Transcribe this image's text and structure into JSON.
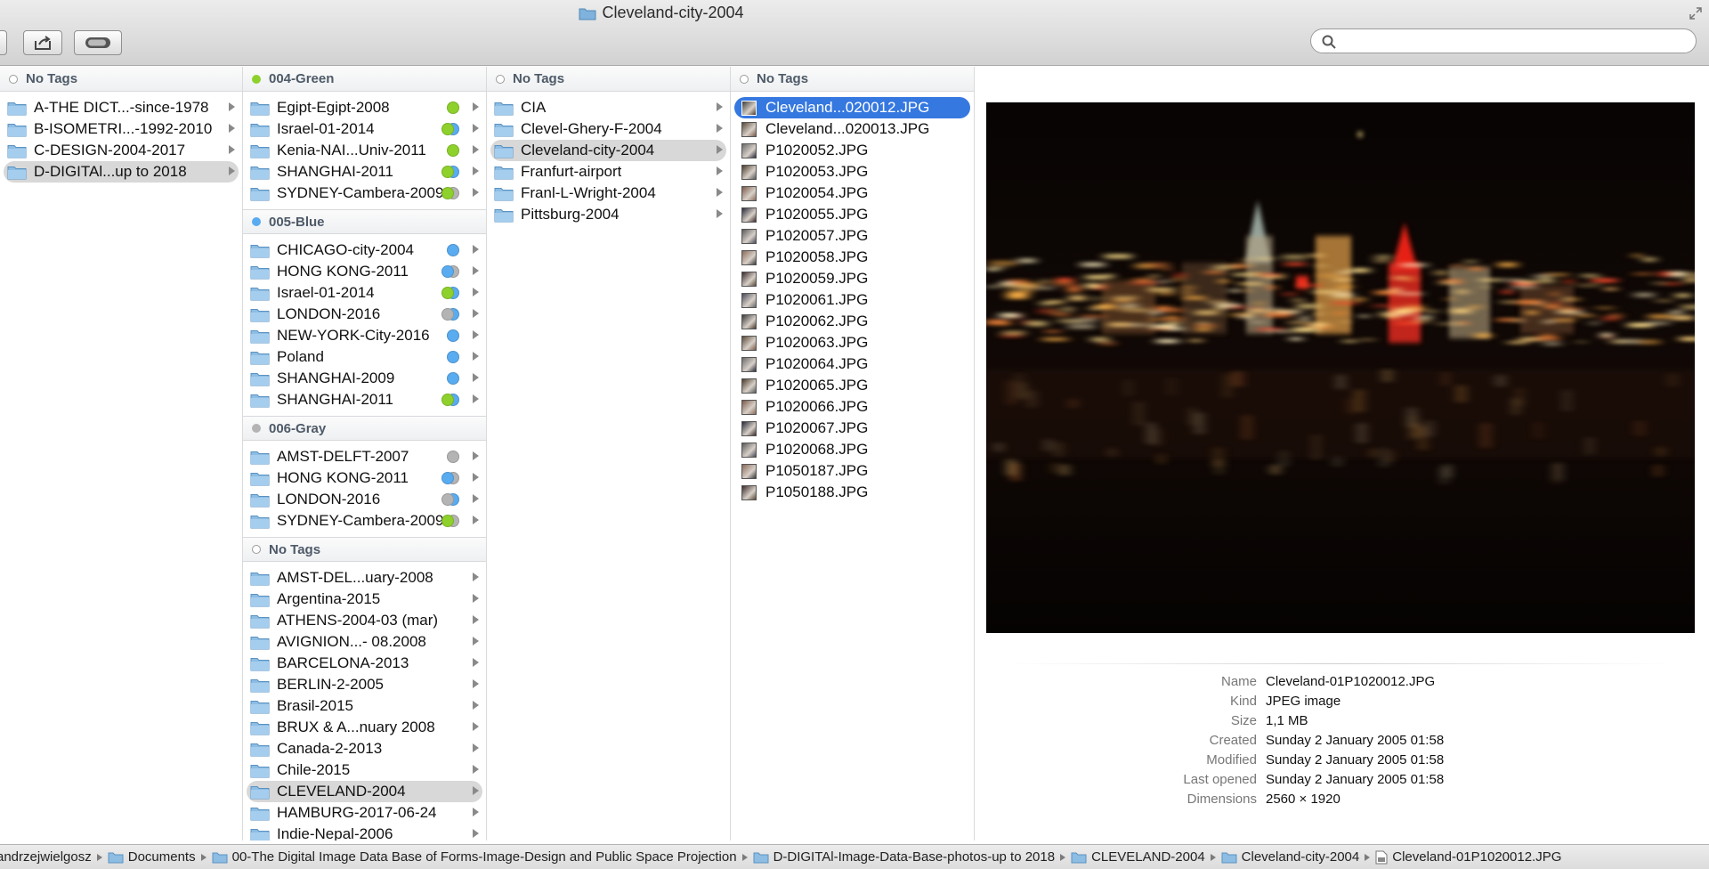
{
  "window": {
    "title": "Cleveland-city-2004"
  },
  "search": {
    "placeholder": "",
    "value": ""
  },
  "columns": [
    {
      "groups": [
        {
          "name": "No Tags",
          "dot": "empty",
          "items": [
            {
              "label": "A-THE DICT...-since-1978",
              "arrow": true
            },
            {
              "label": "B-ISOMETRI...-1992-2010",
              "arrow": true
            },
            {
              "label": "C-DESIGN-2004-2017",
              "arrow": true
            },
            {
              "label": "D-DIGITAl...up to 2018",
              "arrow": true,
              "selected": "gray"
            }
          ]
        }
      ]
    },
    {
      "groups": [
        {
          "name": "004-Green",
          "dot": "#8ed12c",
          "items": [
            {
              "label": "Egipt-Egipt-2008",
              "arrow": true,
              "tags": [
                "#8ed12c"
              ]
            },
            {
              "label": "Israel-01-2014",
              "arrow": true,
              "tags": [
                "#8ed12c",
                "#5aacf0"
              ]
            },
            {
              "label": "Kenia-NAI...Univ-2011",
              "arrow": true,
              "tags": [
                "#8ed12c"
              ]
            },
            {
              "label": "SHANGHAI-2011",
              "arrow": true,
              "tags": [
                "#8ed12c",
                "#5aacf0"
              ]
            },
            {
              "label": "SYDNEY-Cambera-2009",
              "arrow": true,
              "tags": [
                "#8ed12c",
                "#b4b4b4"
              ]
            }
          ]
        },
        {
          "name": "005-Blue",
          "dot": "#5aacf0",
          "items": [
            {
              "label": "CHICAGO-city-2004",
              "arrow": true,
              "tags": [
                "#5aacf0"
              ]
            },
            {
              "label": "HONG KONG-2011",
              "arrow": true,
              "tags": [
                "#5aacf0",
                "#b4b4b4"
              ]
            },
            {
              "label": "Israel-01-2014",
              "arrow": true,
              "tags": [
                "#8ed12c",
                "#5aacf0"
              ]
            },
            {
              "label": "LONDON-2016",
              "arrow": true,
              "tags": [
                "#b4b4b4",
                "#5aacf0"
              ]
            },
            {
              "label": "NEW-YORK-City-2016",
              "arrow": true,
              "tags": [
                "#5aacf0"
              ]
            },
            {
              "label": "Poland",
              "arrow": true,
              "tags": [
                "#5aacf0"
              ]
            },
            {
              "label": "SHANGHAI-2009",
              "arrow": true,
              "tags": [
                "#5aacf0"
              ]
            },
            {
              "label": "SHANGHAI-2011",
              "arrow": true,
              "tags": [
                "#8ed12c",
                "#5aacf0"
              ]
            }
          ]
        },
        {
          "name": "006-Gray",
          "dot": "#b4b4b4",
          "items": [
            {
              "label": "AMST-DELFT-2007",
              "arrow": true,
              "tags": [
                "#b4b4b4"
              ]
            },
            {
              "label": "HONG KONG-2011",
              "arrow": true,
              "tags": [
                "#5aacf0",
                "#b4b4b4"
              ]
            },
            {
              "label": "LONDON-2016",
              "arrow": true,
              "tags": [
                "#b4b4b4",
                "#5aacf0"
              ]
            },
            {
              "label": "SYDNEY-Cambera-2009",
              "arrow": true,
              "tags": [
                "#8ed12c",
                "#b4b4b4"
              ]
            }
          ]
        },
        {
          "name": "No Tags",
          "dot": "empty",
          "items": [
            {
              "label": "AMST-DEL...uary-2008",
              "arrow": true
            },
            {
              "label": "Argentina-2015",
              "arrow": true
            },
            {
              "label": "ATHENS-2004-03 (mar)",
              "arrow": true
            },
            {
              "label": "AVIGNION...- 08.2008",
              "arrow": true
            },
            {
              "label": "BARCELONA-2013",
              "arrow": true
            },
            {
              "label": "BERLIN-2-2005",
              "arrow": true
            },
            {
              "label": "Brasil-2015",
              "arrow": true
            },
            {
              "label": "BRUX & A...nuary 2008",
              "arrow": true
            },
            {
              "label": "Canada-2-2013",
              "arrow": true
            },
            {
              "label": "Chile-2015",
              "arrow": true
            },
            {
              "label": "CLEVELAND-2004",
              "arrow": true,
              "selected": "gray"
            },
            {
              "label": "HAMBURG-2017-06-24",
              "arrow": true
            },
            {
              "label": "Indie-Nepal-2006",
              "arrow": true
            }
          ]
        }
      ]
    },
    {
      "groups": [
        {
          "name": "No Tags",
          "dot": "empty",
          "items": [
            {
              "label": "CIA",
              "arrow": true
            },
            {
              "label": "Clevel-Ghery-F-2004",
              "arrow": true
            },
            {
              "label": "Cleveland-city-2004",
              "arrow": true,
              "selected": "gray"
            },
            {
              "label": "Franfurt-airport",
              "arrow": true
            },
            {
              "label": "Franl-L-Wright-2004",
              "arrow": true
            },
            {
              "label": "Pittsburg-2004",
              "arrow": true
            }
          ]
        }
      ]
    },
    {
      "groups": [
        {
          "name": "No Tags",
          "dot": "empty",
          "items": [
            {
              "label": "Cleveland...020012.JPG",
              "file": true,
              "selected": "blue"
            },
            {
              "label": "Cleveland...020013.JPG",
              "file": true
            },
            {
              "label": "P1020052.JPG",
              "file": true
            },
            {
              "label": "P1020053.JPG",
              "file": true
            },
            {
              "label": "P1020054.JPG",
              "file": true
            },
            {
              "label": "P1020055.JPG",
              "file": true
            },
            {
              "label": "P1020057.JPG",
              "file": true
            },
            {
              "label": "P1020058.JPG",
              "file": true
            },
            {
              "label": "P1020059.JPG",
              "file": true
            },
            {
              "label": "P1020061.JPG",
              "file": true
            },
            {
              "label": "P1020062.JPG",
              "file": true
            },
            {
              "label": "P1020063.JPG",
              "file": true
            },
            {
              "label": "P1020064.JPG",
              "file": true
            },
            {
              "label": "P1020065.JPG",
              "file": true
            },
            {
              "label": "P1020066.JPG",
              "file": true
            },
            {
              "label": "P1020067.JPG",
              "file": true
            },
            {
              "label": "P1020068.JPG",
              "file": true
            },
            {
              "label": "P1050187.JPG",
              "file": true
            },
            {
              "label": "P1050188.JPG",
              "file": true
            }
          ]
        }
      ]
    }
  ],
  "preview": {
    "info": [
      {
        "key": "Name",
        "value": "Cleveland-01P1020012.JPG"
      },
      {
        "key": "Kind",
        "value": "JPEG image"
      },
      {
        "key": "Size",
        "value": "1,1 MB"
      },
      {
        "key": "Created",
        "value": "Sunday 2 January 2005 01:58"
      },
      {
        "key": "Modified",
        "value": "Sunday 2 January 2005 01:58"
      },
      {
        "key": "Last opened",
        "value": "Sunday 2 January 2005 01:58"
      },
      {
        "key": "Dimensions",
        "value": "2560 × 1920"
      }
    ]
  },
  "pathbar": [
    {
      "label": "andrzejwielgosz",
      "icon": "none"
    },
    {
      "label": "Documents",
      "icon": "folder"
    },
    {
      "label": "00-The Digital Image Data Base of Forms-Image-Design and Public Space Projection",
      "icon": "folder"
    },
    {
      "label": "D-DIGITAl-Image-Data-Base-photos-up to 2018",
      "icon": "folder"
    },
    {
      "label": "CLEVELAND-2004",
      "icon": "folder"
    },
    {
      "label": "Cleveland-city-2004",
      "icon": "folder"
    },
    {
      "label": "Cleveland-01P1020012.JPG",
      "icon": "file"
    }
  ],
  "colors": {
    "selection": "#3578e0",
    "folder": "#7fb2dc",
    "tag_green": "#8ed12c",
    "tag_blue": "#5aacf0",
    "tag_gray": "#b4b4b4"
  }
}
